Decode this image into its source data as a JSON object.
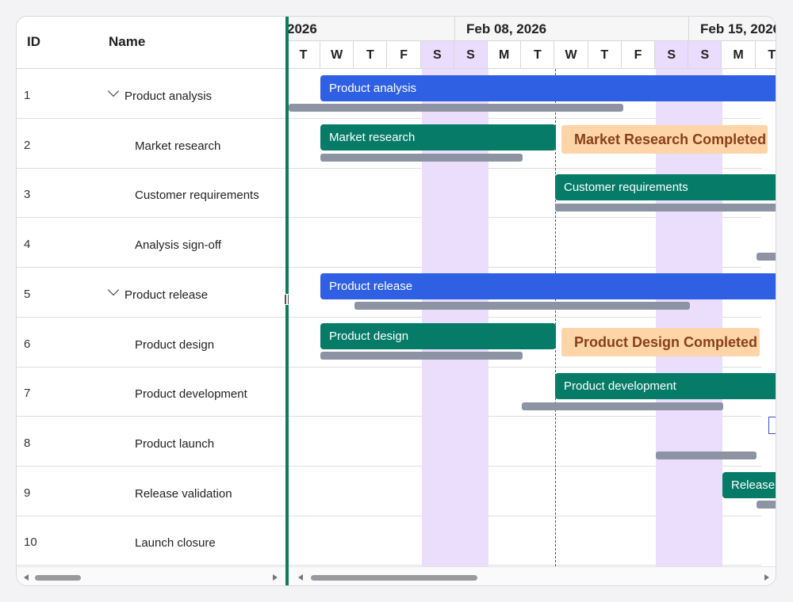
{
  "grid": {
    "columns": {
      "id": "ID",
      "name": "Name"
    },
    "rows": [
      {
        "id": "1",
        "name": "Product analysis",
        "expandable": true
      },
      {
        "id": "2",
        "name": "Market research",
        "expandable": false
      },
      {
        "id": "3",
        "name": "Customer requirements",
        "expandable": false
      },
      {
        "id": "4",
        "name": "Analysis sign-off",
        "expandable": false
      },
      {
        "id": "5",
        "name": "Product release",
        "expandable": true
      },
      {
        "id": "6",
        "name": "Product design",
        "expandable": false
      },
      {
        "id": "7",
        "name": "Product development",
        "expandable": false
      },
      {
        "id": "8",
        "name": "Product launch",
        "expandable": false
      },
      {
        "id": "9",
        "name": "Release validation",
        "expandable": false
      },
      {
        "id": "10",
        "name": "Launch closure",
        "expandable": false
      }
    ]
  },
  "timeline": {
    "weeks": [
      "2026",
      "Feb 08, 2026",
      "Feb 15, 2026"
    ],
    "days": [
      "T",
      "W",
      "T",
      "F",
      "S",
      "S",
      "M",
      "T",
      "W",
      "T",
      "F",
      "S",
      "S",
      "M",
      "T"
    ]
  },
  "tasks": {
    "product_analysis": "Product analysis",
    "market_research": "Market research",
    "customer_requirements": "Customer requirements",
    "product_release": "Product release",
    "product_design": "Product design",
    "product_development": "Product development",
    "release_validation": "Release validation"
  },
  "right_labels": {
    "market_research": "Market Research Completed",
    "product_design": "Product Design Completed"
  },
  "colors": {
    "parent_bar": "#2f5fe3",
    "child_bar": "#067b68",
    "baseline": "#8c93a3",
    "weekend": "#ebdefd",
    "splitter": "#0f7a5c",
    "label_bg": "#fdd5a8"
  }
}
